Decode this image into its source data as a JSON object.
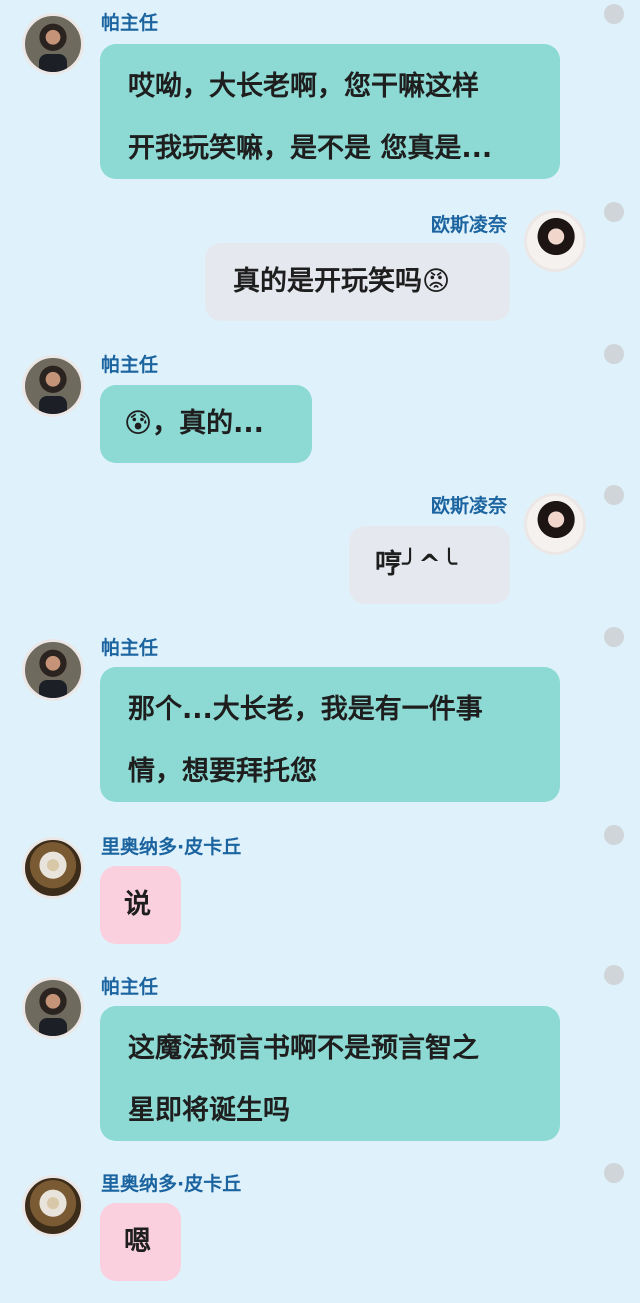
{
  "messages": [
    {
      "sender": "帕主任",
      "lines": [
        "哎呦，大长老啊，您干嘛这样",
        "开我玩笑嘛，是不是 您真是..."
      ],
      "side": "left",
      "avatar": "avatar-man-suit"
    },
    {
      "sender": "欧斯凌奈",
      "lines": [
        "真的是开玩笑吗😡"
      ],
      "side": "right",
      "avatar": "avatar-girl-long-hair"
    },
    {
      "sender": "帕主任",
      "lines": [
        "😰，真的..."
      ],
      "side": "left",
      "avatar": "avatar-man-suit"
    },
    {
      "sender": "欧斯凌奈",
      "lines": [
        "哼╯^╰"
      ],
      "side": "right",
      "avatar": "avatar-girl-long-hair"
    },
    {
      "sender": "帕主任",
      "lines": [
        "那个...大长老，我是有一件事",
        "情，想要拜托您"
      ],
      "side": "left",
      "avatar": "avatar-man-suit"
    },
    {
      "sender": "里奥纳多·皮卡丘",
      "lines": [
        "说"
      ],
      "side": "left",
      "avatar": "avatar-elder-robed"
    },
    {
      "sender": "帕主任",
      "lines": [
        "这魔法预言书啊不是预言智之",
        "星即将诞生吗"
      ],
      "side": "left",
      "avatar": "avatar-man-suit"
    },
    {
      "sender": "里奥纳多·皮卡丘",
      "lines": [
        "嗯"
      ],
      "side": "left",
      "avatar": "avatar-elder-robed"
    }
  ],
  "colors": {
    "background": "#dff2fb",
    "bubble_teal": "#8cdad3",
    "bubble_gray": "#e5e8ee",
    "bubble_pink": "#fbd0de",
    "name": "#1b64a0",
    "status_dot": "#cfd5d8"
  }
}
